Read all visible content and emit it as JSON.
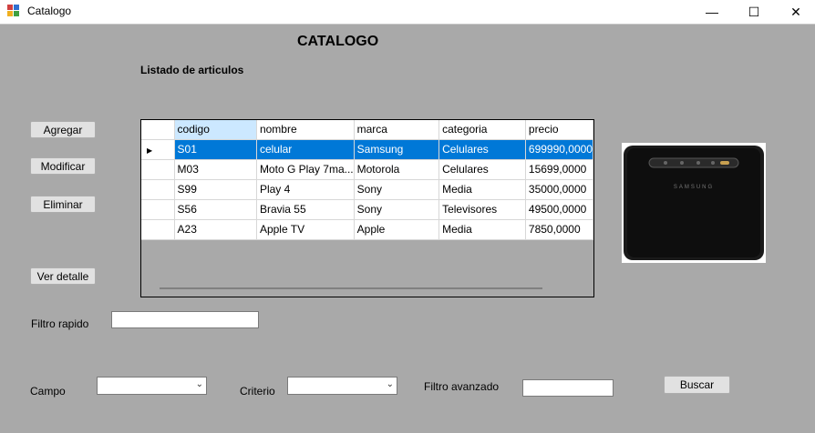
{
  "window": {
    "title": "Catalogo",
    "minimize_glyph": "—",
    "maximize_glyph": "☐",
    "close_glyph": "✕"
  },
  "header": {
    "title": "CATALOGO",
    "subtitle": "Listado de articulos"
  },
  "buttons": {
    "add": "Agregar",
    "modify": "Modificar",
    "delete": "Eliminar",
    "details": "Ver detalle",
    "search": "Buscar"
  },
  "grid": {
    "columns": [
      "codigo",
      "nombre",
      "marca",
      "categoria",
      "precio"
    ],
    "rows": [
      [
        "S01",
        "celular",
        "Samsung",
        "Celulares",
        "699990,0000"
      ],
      [
        "M03",
        "Moto G Play 7ma...",
        "Motorola",
        "Celulares",
        "15699,0000"
      ],
      [
        "S99",
        "Play 4",
        "Sony",
        "Media",
        "35000,0000"
      ],
      [
        "S56",
        "Bravia 55",
        "Sony",
        "Televisores",
        "49500,0000"
      ],
      [
        "A23",
        "Apple TV",
        "Apple",
        "Media",
        "7850,0000"
      ]
    ],
    "selected_row": 0
  },
  "filters": {
    "quick_label": "Filtro rapido",
    "quick_value": "",
    "field_label": "Campo",
    "field_value": "",
    "criteria_label": "Criterio",
    "criteria_value": "",
    "advanced_label": "Filtro avanzado",
    "advanced_value": ""
  },
  "image": {
    "brand_text": "SAMSUNG",
    "icon": "phone-image"
  },
  "colors": {
    "background": "#a9a9a9",
    "selection": "#0078d7",
    "selected_header": "#cce8ff"
  }
}
